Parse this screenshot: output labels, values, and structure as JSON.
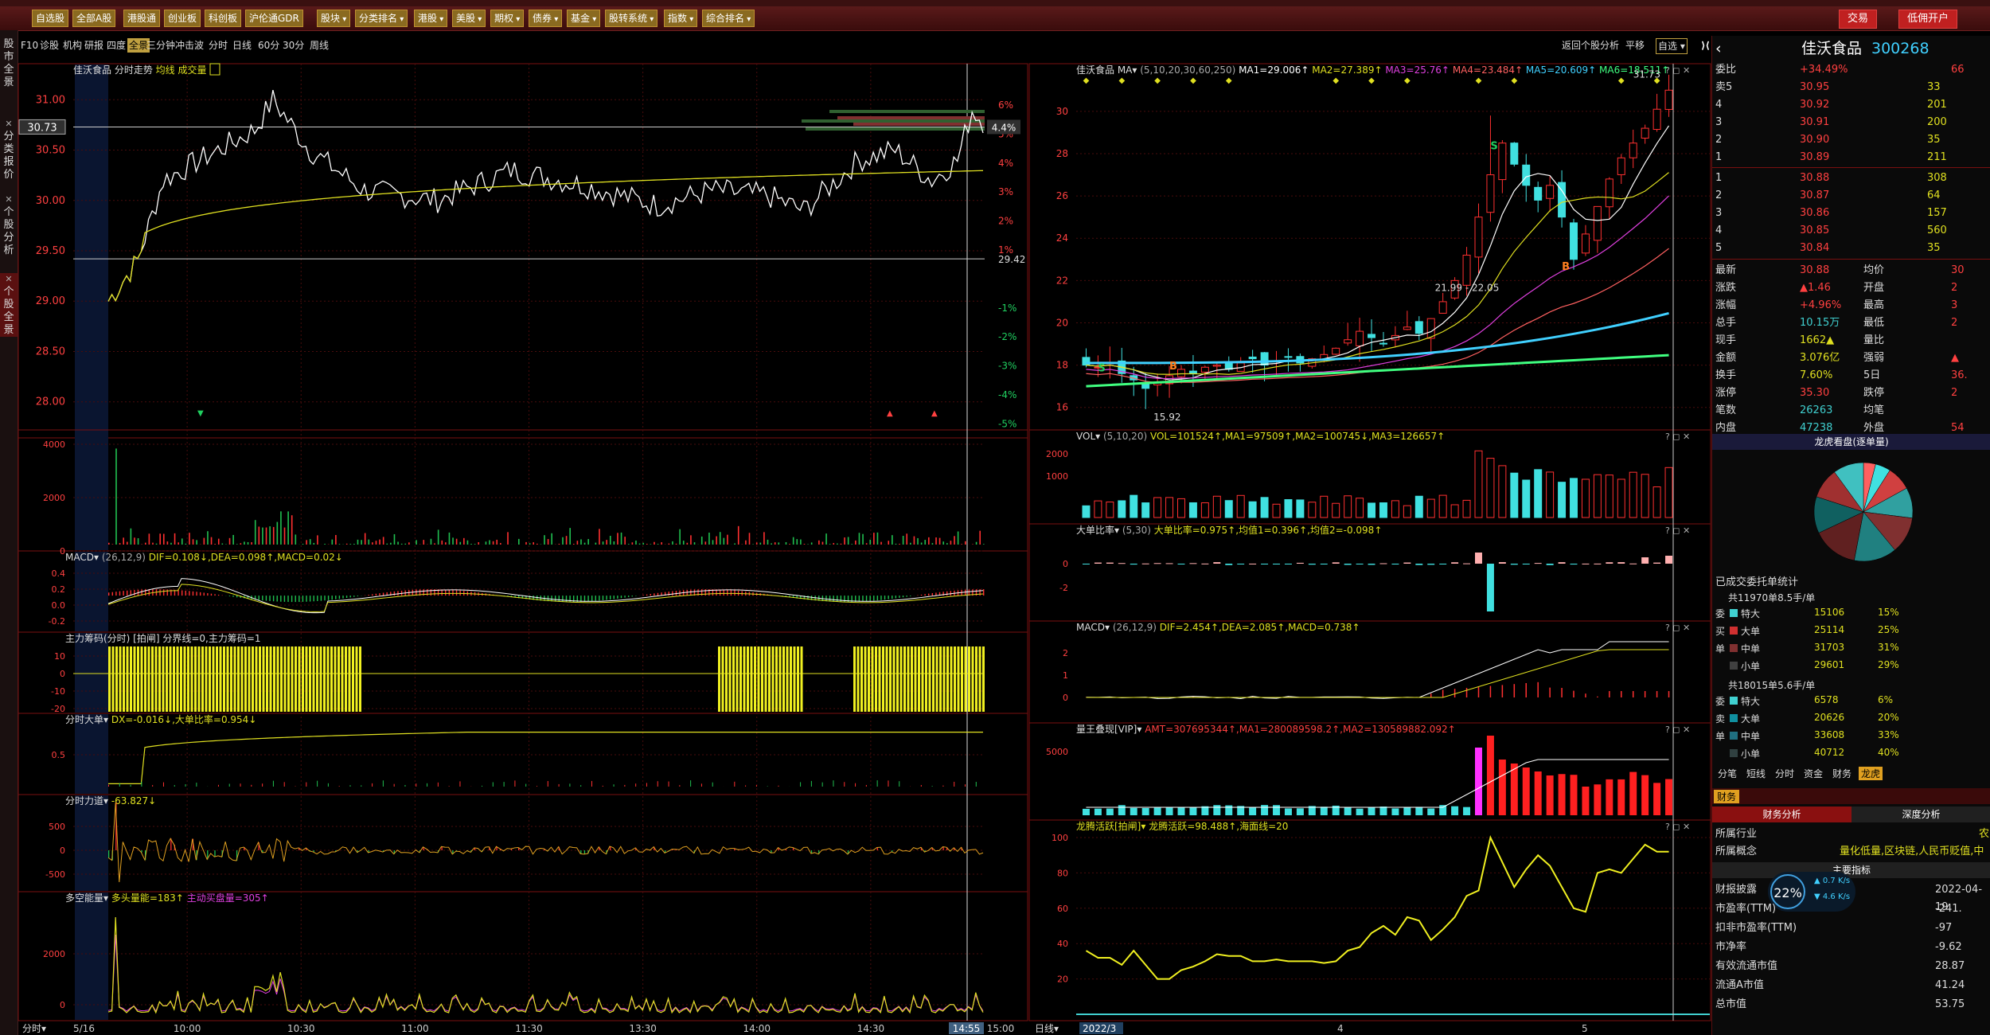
{
  "menubar": {
    "items": [
      "自选股",
      "全部A股",
      "港股通",
      "创业板",
      "科创板",
      "沪伦通GDR",
      "股块",
      "分类排名",
      "港股",
      "美股",
      "期权",
      "债券",
      "基金",
      "股转系统",
      "指数",
      "综合排名"
    ],
    "trade_button": "交易",
    "margin_button": "低佣开户"
  },
  "left_tabs": [
    "股市全景",
    "分类报价",
    "个股分析",
    "个股全景"
  ],
  "toolbar": {
    "items": [
      "F10",
      "诊股",
      "机构",
      "研报",
      "四度",
      "全景",
      "三分钟",
      "冲击波",
      "分时",
      "日线",
      "60分",
      "30分",
      "周线"
    ],
    "right_items": [
      "返回个股分析",
      "平移",
      "自选"
    ]
  },
  "intraday": {
    "title": "佳沃食品",
    "subtitle": "分时走势",
    "lines_label": "均线 成交量",
    "price_ticks": [
      "31.00",
      "30.50",
      "30.00",
      "29.50",
      "29.00",
      "28.50",
      "28.00"
    ],
    "pct_ticks": [
      "6%",
      "5%",
      "4%",
      "3%",
      "2%",
      "1%",
      "",
      "-1%",
      "-2%",
      "-3%",
      "-4%",
      "-5%"
    ],
    "current_price": "30.73",
    "current_pct": "4.4%",
    "pre_close": "29.42",
    "x_labels": [
      "5/16",
      "10:00",
      "10:30",
      "11:00",
      "11:30",
      "13:30",
      "14:00",
      "14:30",
      "14:55",
      "15:00"
    ],
    "vol_ticks": [
      "4000",
      "2000",
      "0"
    ],
    "macd_title": "MACD",
    "macd_params": "(26,12,9)",
    "macd_vals": "DIF=0.108↓,DEA=0.098↑,MACD=0.02↓",
    "macd_ticks": [
      "0.4",
      "0.2",
      "0.0",
      "-0.2"
    ],
    "chip_title": "主力筹码(分时) [拍闸]",
    "chip_vals": "分界线=0,主力筹码=1",
    "chip_ticks": [
      "10",
      "0",
      "-10",
      "-20"
    ],
    "big_title": "分时大单",
    "big_vals": "DX=-0.016↓,大单比率=0.954↓",
    "big_ticks": [
      "0.5"
    ],
    "force_title": "分时力道",
    "force_vals": "-63.827↓",
    "force_ticks": [
      "500",
      "0",
      "-500"
    ],
    "ls_title": "多空能量",
    "ls_vals": "多头量能=183↑",
    "ls_vals2": "主动买盘量=305↑",
    "ls_ticks": [
      "2000",
      "0"
    ],
    "footer_label": "分时"
  },
  "daily": {
    "title": "佳沃食品",
    "ma_label": "MA",
    "ma_params": "(5,10,20,30,60,250)",
    "ma1": "MA1=29.006↑",
    "ma2": "MA2=27.389↑",
    "ma3": "MA3=25.76↑",
    "ma4": "MA4=23.484↑",
    "ma5": "MA5=20.609↑",
    "ma6": "MA6=18.511↑",
    "price_ticks": [
      "30",
      "28",
      "26",
      "24",
      "22",
      "20",
      "18",
      "16"
    ],
    "annot_low": "15.92",
    "annot_range": "21.99 - 22.05",
    "annot_high": "31.73",
    "vol_title": "VOL",
    "vol_params": "(5,10,20)",
    "vol_vals": "VOL=101524↑,MA1=97509↑,MA2=100745↓,MA3=126657↑",
    "vol_ticks": [
      "2000",
      "1000"
    ],
    "bigratio_title": "大单比率",
    "bigratio_params": "(5,30)",
    "bigratio_vals": "大单比率=0.975↑,均值1=0.396↑,均值2=-0.098↑",
    "bigratio_ticks": [
      "0",
      "-2"
    ],
    "macd_title": "MACD",
    "macd_params": "(26,12,9)",
    "macd_vals": "DIF=2.454↑,DEA=2.085↑,MACD=0.738↑",
    "macd_ticks": [
      "2",
      "1",
      "0"
    ],
    "amt_title": "量王叠现[VIP]",
    "amt_vals": "AMT=307695344↑,MA1=280089598.2↑,MA2=130589882.092↑",
    "amt_ticks": [
      "5000"
    ],
    "dragon_title": "龙腾活跃[拍闸]",
    "dragon_vals": "龙腾活跃=98.488↑,海面线=20",
    "dragon_ticks": [
      "100",
      "80",
      "60",
      "40",
      "20"
    ],
    "x_labels": [
      "2022/3",
      "4",
      "5"
    ],
    "footer_label": "日线"
  },
  "sidebar": {
    "name": "佳沃食品",
    "code": "300268",
    "weibi_label": "委比",
    "weibi_val": "+34.49%",
    "weibi_diff": "66",
    "sell": [
      {
        "label": "卖5",
        "price": "30.95",
        "vol": "33"
      },
      {
        "label": "4",
        "price": "30.92",
        "vol": "201"
      },
      {
        "label": "3",
        "price": "30.91",
        "vol": "200"
      },
      {
        "label": "2",
        "price": "30.90",
        "vol": "35"
      },
      {
        "label": "1",
        "price": "30.89",
        "vol": "211"
      }
    ],
    "buy": [
      {
        "label": "1",
        "price": "30.88",
        "vol": "308"
      },
      {
        "label": "2",
        "price": "30.87",
        "vol": "64"
      },
      {
        "label": "3",
        "price": "30.86",
        "vol": "157"
      },
      {
        "label": "4",
        "price": "30.85",
        "vol": "560"
      },
      {
        "label": "5",
        "price": "30.84",
        "vol": "35"
      }
    ],
    "stats": [
      {
        "l": "最新",
        "v": "30.88",
        "l2": "均价",
        "v2": "30"
      },
      {
        "l": "涨跌",
        "v": "▲1.46",
        "l2": "开盘",
        "v2": "2"
      },
      {
        "l": "涨幅",
        "v": "+4.96%",
        "l2": "最高",
        "v2": "3"
      },
      {
        "l": "总手",
        "v": "10.15万",
        "l2": "最低",
        "v2": "2"
      },
      {
        "l": "现手",
        "v": "1662▲",
        "l2": "量比",
        "v2": ""
      },
      {
        "l": "金额",
        "v": "3.076亿",
        "l2": "强弱",
        "v2": "▲"
      },
      {
        "l": "换手",
        "v": "7.60%",
        "l2": "5日",
        "v2": "36."
      },
      {
        "l": "涨停",
        "v": "35.30",
        "l2": "跌停",
        "v2": "2"
      },
      {
        "l": "笔数",
        "v": "26263",
        "l2": "均笔",
        "v2": ""
      },
      {
        "l": "内盘",
        "v": "47238",
        "l2": "外盘",
        "v2": "54"
      }
    ],
    "pie_title": "龙虎看盘(逐单量)",
    "deal_title": "已成交委托单统计",
    "group1_header": "共11970单8.5手/单",
    "group1": [
      {
        "l": "特大",
        "v": "15106",
        "p": "15%",
        "c": "#40d0d0"
      },
      {
        "l": "大单",
        "v": "25114",
        "p": "25%",
        "c": "#d03030"
      },
      {
        "l": "中单",
        "v": "31703",
        "p": "31%",
        "c": "#803030"
      },
      {
        "l": "小单",
        "v": "29601",
        "p": "29%",
        "c": "#404040"
      }
    ],
    "group1_side": [
      "委",
      "买",
      "单"
    ],
    "group2_header": "共18015单5.6手/单",
    "group2": [
      {
        "l": "特大",
        "v": "6578",
        "p": "6%",
        "c": "#40d0d0"
      },
      {
        "l": "大单",
        "v": "20626",
        "p": "20%",
        "c": "#1090a0"
      },
      {
        "l": "中单",
        "v": "33608",
        "p": "33%",
        "c": "#207080"
      },
      {
        "l": "小单",
        "v": "40712",
        "p": "40%",
        "c": "#304040"
      }
    ],
    "group2_side": [
      "委",
      "卖",
      "单"
    ],
    "tabs": [
      "分笔",
      "短线",
      "分时",
      "资金",
      "财务",
      "龙虎"
    ],
    "fin_tab": "财务",
    "fin_tabs": [
      "财务分析",
      "深度分析"
    ],
    "industry_label": "所属行业",
    "industry_val": "农",
    "concept_label": "所属概念",
    "concept_val": "量化低量,区块链,人民币贬值,中",
    "main_index": "主要指标",
    "speed_pct": "22%",
    "speed_up": "0.7",
    "speed_down": "4.6",
    "speed_unit": "K/s",
    "fin_rows": [
      {
        "l": "财报披露",
        "v": "2022-04-19"
      },
      {
        "l": "市盈率(TTM)",
        "v": "-241."
      },
      {
        "l": "扣非市盈率(TTM)",
        "v": "-97"
      },
      {
        "l": "市净率",
        "v": "-9.62"
      },
      {
        "l": "有效流通市值",
        "v": "28.87"
      },
      {
        "l": "流通A市值",
        "v": "41.24"
      },
      {
        "l": "总市值",
        "v": "53.75"
      }
    ]
  },
  "pie_data": [
    0.04,
    0.05,
    0.08,
    0.1,
    0.12,
    0.14,
    0.15,
    0.12,
    0.1,
    0.1
  ]
}
